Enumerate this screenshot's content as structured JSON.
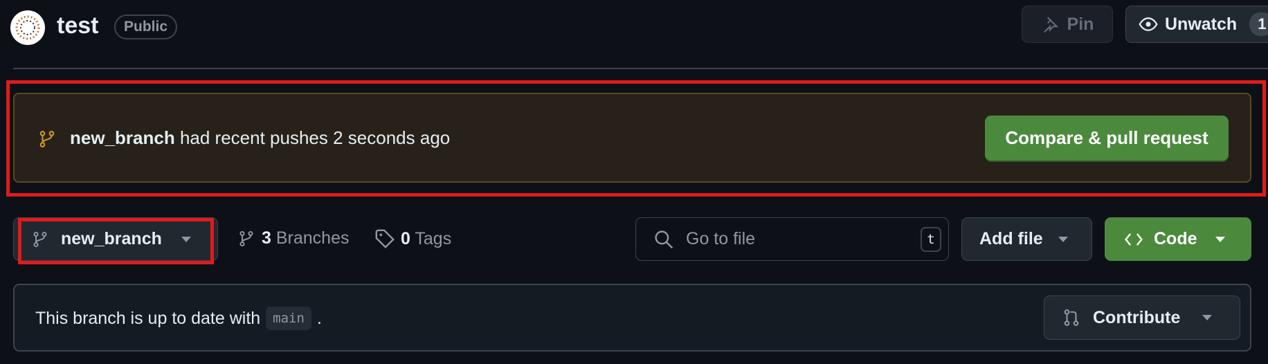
{
  "repo": {
    "name": "test",
    "visibility": "Public"
  },
  "header": {
    "pin_label": "Pin",
    "unwatch_label": "Unwatch",
    "watch_count": "1"
  },
  "banner": {
    "branch": "new_branch",
    "message": "had recent pushes 2 seconds ago",
    "button": "Compare & pull request"
  },
  "toolbar": {
    "branch": "new_branch",
    "branches_count": "3",
    "branches_label": "Branches",
    "tags_count": "0",
    "tags_label": "Tags",
    "search_placeholder": "Go to file",
    "search_shortcut": "t",
    "add_file": "Add file",
    "code": "Code"
  },
  "status": {
    "text": "This branch is up to date with",
    "base": "main",
    "suffix": ".",
    "contribute": "Contribute"
  },
  "colors": {
    "accent_green": "#4b8a3d",
    "banner_bg": "#272119",
    "banner_border": "#5c4a1e",
    "highlight_red": "#e01b1b",
    "branch_icon": "#d29922"
  }
}
